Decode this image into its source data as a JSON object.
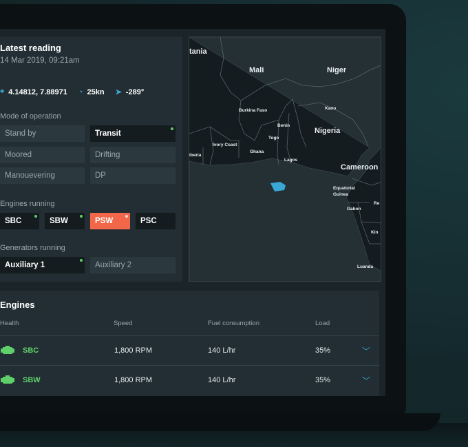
{
  "reading": {
    "title": "Latest reading",
    "timestamp": "14 Mar 2019, 09:21am",
    "coordinates": "4.14812, 7.88971",
    "speed": "25kn",
    "heading": "-289°"
  },
  "mode": {
    "label": "Mode of operation",
    "options": [
      "Stand by",
      "Transit",
      "Moored",
      "Drifting",
      "Manouevering",
      "DP"
    ],
    "active": "Transit"
  },
  "engines_running": {
    "label": "Engines running",
    "items": [
      "SBC",
      "SBW",
      "PSW",
      "PSC"
    ]
  },
  "generators_running": {
    "label": "Generators running",
    "items": [
      "Auxiliary 1",
      "Auxiliary 2"
    ]
  },
  "map": {
    "labels": [
      "tania",
      "Mali",
      "Niger",
      "Burkina Faso",
      "Kano",
      "Benin",
      "Nigeria",
      "Togo",
      "Ivory Coast",
      "Ghana",
      "iberia",
      "Lagos",
      "Cameroon",
      "Equatorial Guinea",
      "Gabon",
      "Re",
      "Kin",
      "Luanda"
    ]
  },
  "engines_table": {
    "title": "Engines",
    "headers": [
      "Health",
      "Speed",
      "Fuel consumption",
      "Load"
    ],
    "rows": [
      {
        "name": "SBC",
        "speed": "1,800 RPM",
        "fuel": "140 L/hr",
        "load": "35%"
      },
      {
        "name": "SBW",
        "speed": "1,800 RPM",
        "fuel": "140 L/hr",
        "load": "35%"
      }
    ]
  },
  "colors": {
    "accent": "#3fa9d6",
    "ok": "#5fcf6a",
    "warning": "#f2674a"
  }
}
